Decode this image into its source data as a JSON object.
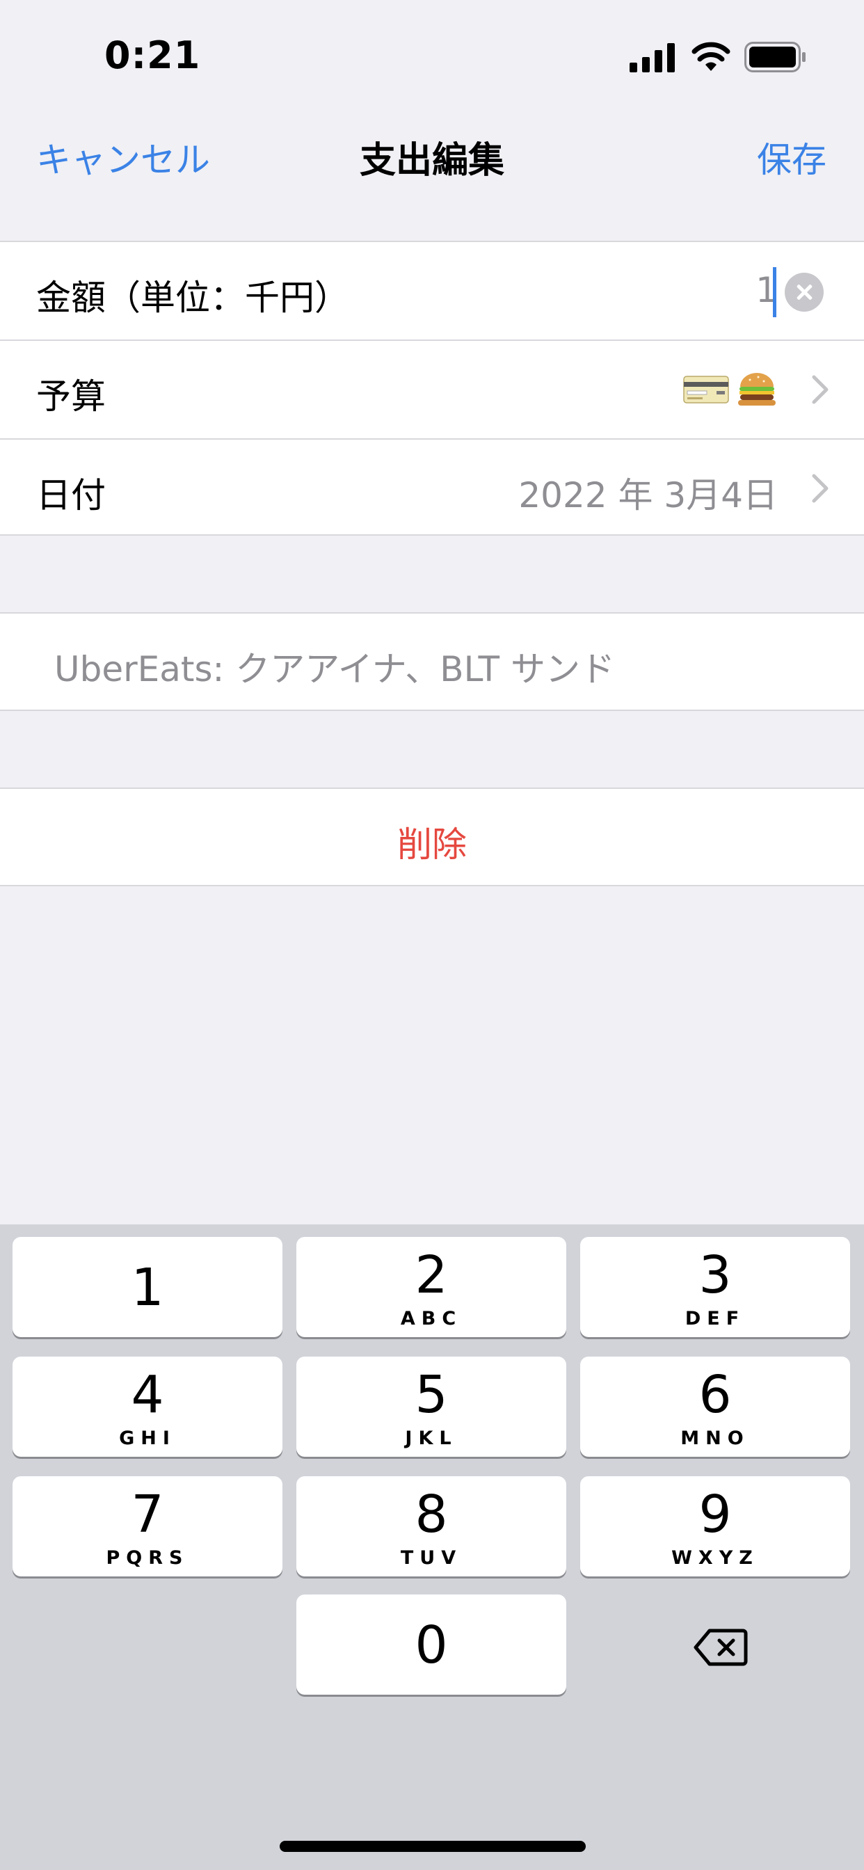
{
  "status_bar": {
    "time": "0:21"
  },
  "nav": {
    "cancel": "キャンセル",
    "title": "支出編集",
    "save": "保存"
  },
  "form": {
    "amount_label": "金額（単位：千円）",
    "amount_value": "1",
    "budget_label": "予算",
    "budget_icons": [
      "credit-card-icon",
      "hamburger-icon"
    ],
    "date_label": "日付",
    "date_value": "2022 年 3月4日"
  },
  "memo": {
    "text": "UberEats: クアアイナ、BLT サンド"
  },
  "delete": {
    "label": "削除"
  },
  "keyboard": {
    "keys": [
      {
        "digit": "1",
        "letters": ""
      },
      {
        "digit": "2",
        "letters": "ABC"
      },
      {
        "digit": "3",
        "letters": "DEF"
      },
      {
        "digit": "4",
        "letters": "GHI"
      },
      {
        "digit": "5",
        "letters": "JKL"
      },
      {
        "digit": "6",
        "letters": "MNO"
      },
      {
        "digit": "7",
        "letters": "PQRS"
      },
      {
        "digit": "8",
        "letters": "TUV"
      },
      {
        "digit": "9",
        "letters": "WXYZ"
      },
      {
        "digit": "0",
        "letters": ""
      }
    ]
  },
  "colors": {
    "accent": "#3a82e6",
    "destructive": "#e5483f",
    "background": "#f0f0f5",
    "keyboard": "#d1d3d9"
  }
}
